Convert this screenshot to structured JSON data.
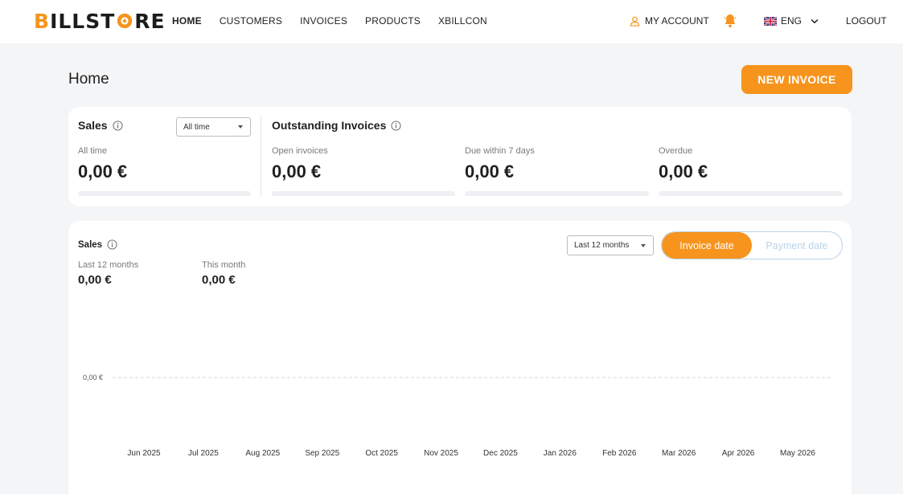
{
  "brand": {
    "logo_text": "BILLSTORE",
    "accent": "#f7941d"
  },
  "nav": {
    "items": [
      {
        "label": "HOME",
        "active": true
      },
      {
        "label": "CUSTOMERS",
        "active": false
      },
      {
        "label": "INVOICES",
        "active": false
      },
      {
        "label": "PRODUCTS",
        "active": false
      },
      {
        "label": "XBILLCON",
        "active": false
      }
    ],
    "account_label": "MY ACCOUNT",
    "language_label": "ENG",
    "logout_label": "LOGOUT"
  },
  "page": {
    "title": "Home",
    "new_invoice_label": "NEW INVOICE"
  },
  "summary": {
    "sales": {
      "title": "Sales",
      "filter_value": "All time",
      "period_label": "All time",
      "value": "0,00 €"
    },
    "outstanding": {
      "title": "Outstanding Invoices",
      "items": [
        {
          "label": "Open invoices",
          "value": "0,00 €"
        },
        {
          "label": "Due within 7 days",
          "value": "0,00 €"
        },
        {
          "label": "Overdue",
          "value": "0,00 €"
        }
      ]
    }
  },
  "sales_chart_panel": {
    "title": "Sales",
    "range_select_value": "Last 12 months",
    "toggle": {
      "options": [
        "Invoice date",
        "Payment date"
      ],
      "selected": "Invoice date"
    },
    "stats": [
      {
        "label": "Last 12 months",
        "value": "0,00 €"
      },
      {
        "label": "This month",
        "value": "0,00 €"
      }
    ]
  },
  "chart_data": {
    "type": "line",
    "x": [
      "Jun 2025",
      "Jul 2025",
      "Aug 2025",
      "Sep 2025",
      "Oct 2025",
      "Nov 2025",
      "Dec 2025",
      "Jan 2026",
      "Feb 2026",
      "Mar 2026",
      "Apr 2026",
      "May 2026"
    ],
    "series": [
      {
        "values": [
          0,
          0,
          0,
          0,
          0,
          0,
          0,
          0,
          0,
          0,
          0,
          0
        ]
      }
    ],
    "y_tick_labels": [
      "0,00 €"
    ],
    "grid": "dashed horizontal at 0",
    "title": "",
    "xlabel": "",
    "ylabel": ""
  }
}
